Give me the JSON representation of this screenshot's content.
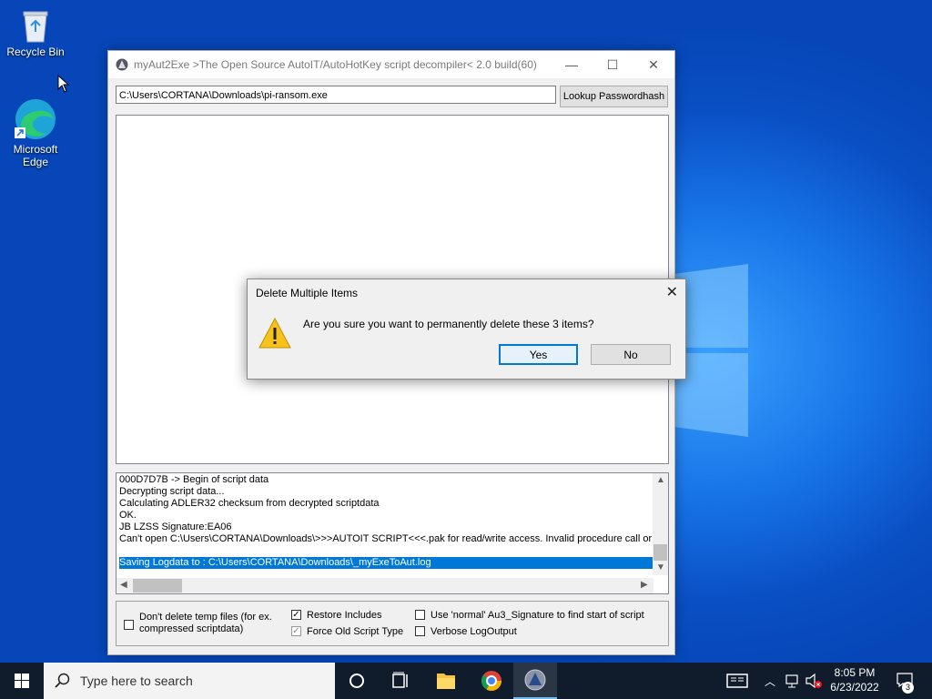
{
  "desktop": {
    "icons": [
      {
        "label": "Recycle Bin"
      },
      {
        "label": "Microsoft Edge"
      }
    ]
  },
  "main_window": {
    "title": "myAut2Exe >The Open Source AutoIT/AutoHotKey script decompiler< 2.0 build(60)",
    "minimize_symbol": "—",
    "maximize_symbol": "☐",
    "close_symbol": "✕",
    "path_value": "C:\\Users\\CORTANA\\Downloads\\pi-ransom.exe",
    "lookup_button": "Lookup Passwordhash",
    "log_lines": [
      "000D7D7B -> Begin of script data",
      "Decrypting script data...",
      "Calculating ADLER32 checksum from decrypted scriptdata",
      "   OK.",
      "JB LZSS Signature:EA06",
      "Can't open C:\\Users\\CORTANA\\Downloads\\>>>AUTOIT SCRIPT<<<.pak for read/write access. Invalid procedure call or a"
    ],
    "log_selected_line": "Saving Logdata to : C:\\Users\\CORTANA\\Downloads\\_myExeToAut.log",
    "options": {
      "dont_delete_temp": {
        "label_line1": "Don't delete temp files (for ex.",
        "label_line2": "compressed scriptdata)",
        "checked": false
      },
      "restore_includes": {
        "label": "Restore Includes",
        "checked": true
      },
      "force_old_script": {
        "label": "Force Old Script Type",
        "checked": true,
        "disabled": true
      },
      "use_normal_sig": {
        "label": "Use 'normal' Au3_Signature to find start of script",
        "checked": false
      },
      "verbose_log": {
        "label": "Verbose LogOutput",
        "checked": false
      }
    }
  },
  "dialog": {
    "title": "Delete Multiple Items",
    "close_symbol": "✕",
    "message": "Are you sure you want to permanently delete these 3 items?",
    "yes_label": "Yes",
    "no_label": "No"
  },
  "taskbar": {
    "search_placeholder": "Type here to search",
    "time": "8:05 PM",
    "date": "6/23/2022",
    "notification_count": "3"
  },
  "colors": {
    "accent": "#0078d7",
    "taskbar": "#101b2b",
    "desktop": "#0a4fc4"
  }
}
